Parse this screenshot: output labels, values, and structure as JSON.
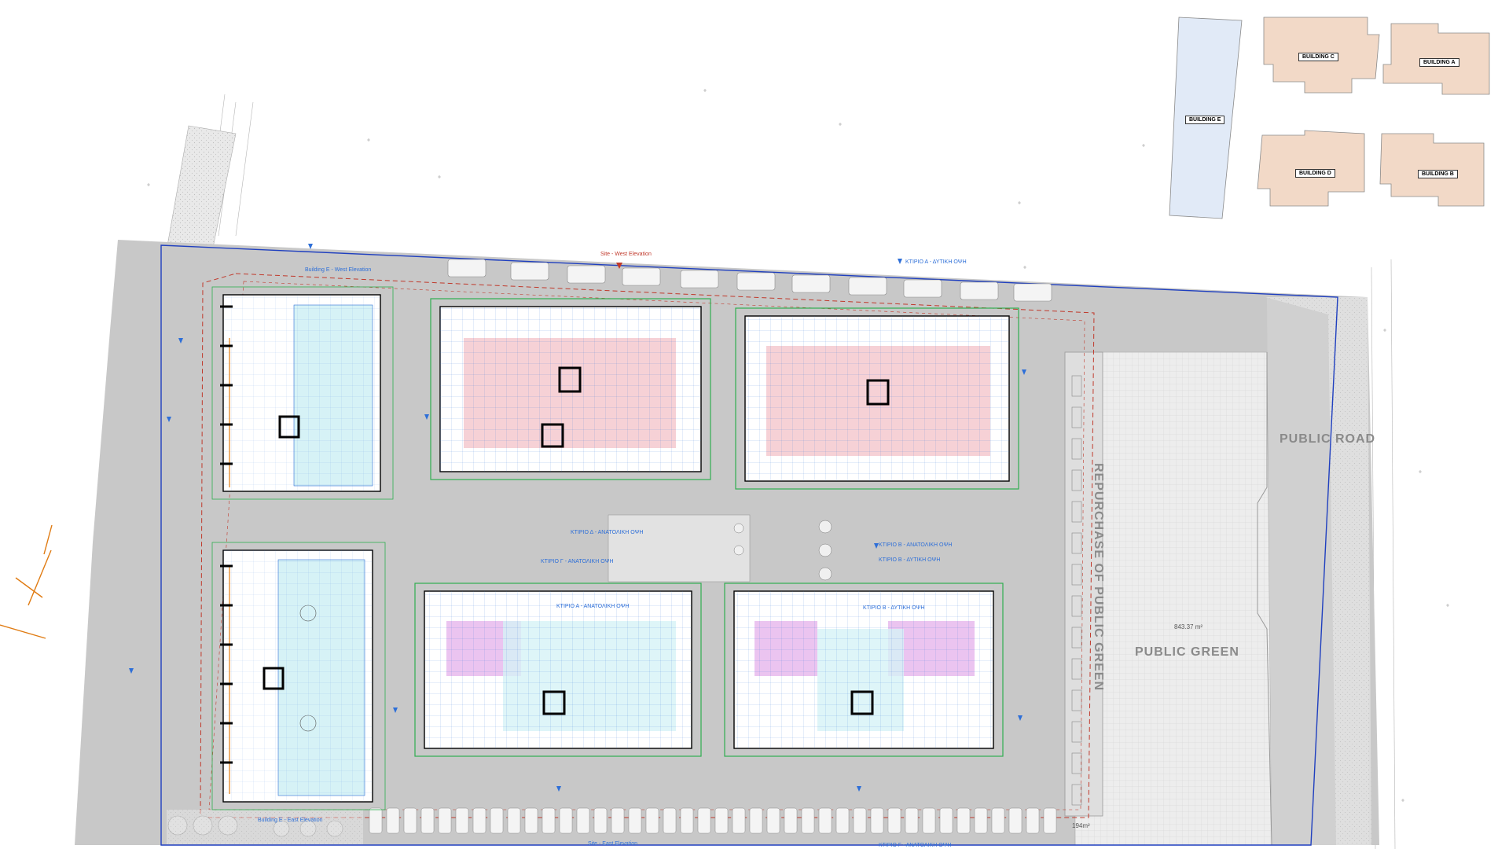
{
  "site": {
    "public_road_label": "PUBLIC ROAD",
    "public_green_label": "PUBLIC GREEN",
    "repurchase_label": "REPURCHASE OF PUBLIC GREEN",
    "green_area_value": "843.37 m²",
    "corner_area_value": "194m²",
    "north_elevation_label": "Site - West Elevation",
    "south_elevation_label": "Site - East Elevation"
  },
  "key_plan": {
    "buildings": [
      {
        "id": "E",
        "label": "BUILDING E"
      },
      {
        "id": "C",
        "label": "BUILDING C"
      },
      {
        "id": "A",
        "label": "BUILDING A"
      },
      {
        "id": "D",
        "label": "BUILDING D"
      },
      {
        "id": "B",
        "label": "BUILDING B"
      }
    ]
  },
  "annotations": {
    "top_arrow_1": "ΚΤΙΡΙΟ Α - ΔΥΤΙΚΗ ΟΨΗ",
    "top_arrow_2": "Building E - West Elevation",
    "mid_arrow_1": "ΚΤΙΡΙΟ Γ - ΑΝΑΤΟΛΙΚΗ ΟΨΗ",
    "mid_arrow_2": "ΚΤΙΡΙΟ Δ - ΑΝΑΤΟΛΙΚΗ ΟΨΗ",
    "mid_arrow_3": "ΚΤΙΡΙΟ Β - ΑΝΑΤΟΛΙΚΗ ΟΨΗ",
    "mid_arrow_4": "ΚΤΙΡΙΟ Β - ΔΥΤΙΚΗ ΟΨΗ",
    "low_arrow_1": "ΚΤΙΡΙΟ Α - ΑΝΑΤΟΛΙΚΗ ΟΨΗ",
    "low_arrow_2": "ΚΤΙΡΙΟ Β - ΔΥΤΙΚΗ ΟΨΗ",
    "bottom_arrow": "ΚΤΙΡΙΟ Γ - ΑΝΑΤΟΛΙΚΗ ΟΨΗ",
    "west_strip_label": "Building E - East Elevation"
  },
  "colors": {
    "pavement": "#c8c8c8",
    "site_boundary": "#1f3fbf",
    "setback": "#c0392b",
    "green_wall": "#2fae4f",
    "dimension": "#2e6fd8",
    "kitchen_pink": "#f5c9cf",
    "bath_cyan": "#d6f2f6",
    "magenta_room": "#e6b5ec",
    "key_blue": "#e1eaf7",
    "key_tan": "#f2d9c7",
    "orange_marks": "#e07b12"
  }
}
